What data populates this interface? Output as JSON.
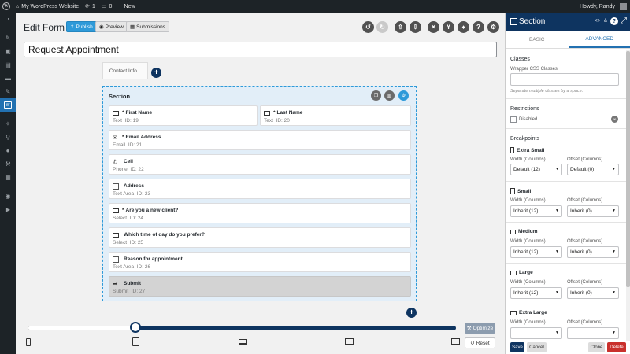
{
  "admin_bar": {
    "site_name": "My WordPress Website",
    "updates_count": "1",
    "comments_count": "0",
    "new_label": "New",
    "greeting": "Howdy, Randy"
  },
  "builder": {
    "title": "Edit Form",
    "publish_label": "Publish",
    "preview_label": "Preview",
    "submissions_label": "Submissions",
    "form_title": "Request Appointment",
    "page_tab": "Contact Info..."
  },
  "section": {
    "label": "Section",
    "fields": [
      {
        "label": "First Name",
        "required": "*",
        "type": "Text",
        "id": "ID: 19"
      },
      {
        "label": "Last Name",
        "required": "*",
        "type": "Text",
        "id": "ID: 20"
      },
      {
        "label": "Email Address",
        "required": "*",
        "type": "Email",
        "id": "ID: 21"
      },
      {
        "label": "Cell",
        "required": "",
        "type": "Phone",
        "id": "ID: 22"
      },
      {
        "label": "Address",
        "required": "",
        "type": "Text Area",
        "id": "ID: 23"
      },
      {
        "label": "Are you a new client?",
        "required": "*",
        "type": "Select",
        "id": "ID: 24"
      },
      {
        "label": "Which time of day do you prefer?",
        "required": "",
        "type": "Select",
        "id": "ID: 25"
      },
      {
        "label": "Reason for appointment",
        "required": "",
        "type": "Text Area",
        "id": "ID: 26"
      },
      {
        "label": "Submit",
        "required": "",
        "type": "Submit",
        "id": "ID: 27"
      }
    ]
  },
  "controls": {
    "optimize_label": "Optimize",
    "reset_label": "Reset"
  },
  "panel": {
    "title": "Section",
    "tabs": [
      "BASIC",
      "ADVANCED"
    ],
    "active_tab": "ADVANCED",
    "classes_heading": "Classes",
    "wrapper_css_label": "Wrapper CSS Classes",
    "wrapper_css_value": "",
    "wrapper_css_help": "Separate multiple classes by a space.",
    "restrictions_heading": "Restrictions",
    "disabled_label": "Disabled",
    "breakpoints_heading": "Breakpoints",
    "width_label": "Width (Columns)",
    "offset_label": "Offset (Columns)",
    "breakpoints": [
      {
        "name": "Extra Small",
        "width": "Default (12)",
        "offset": "Default (0)"
      },
      {
        "name": "Small",
        "width": "Inherit (12)",
        "offset": "Inherit (0)"
      },
      {
        "name": "Medium",
        "width": "Inherit (12)",
        "offset": "Inherit (0)"
      },
      {
        "name": "Large",
        "width": "Inherit (12)",
        "offset": "Inherit (0)"
      },
      {
        "name": "Extra Large",
        "width": "",
        "offset": ""
      }
    ],
    "save_label": "Save",
    "cancel_label": "Cancel",
    "clone_label": "Clone",
    "delete_label": "Delete"
  },
  "colors": {
    "primary_navy": "#0e3460",
    "accent_blue": "#2e9ad9",
    "delete_red": "#c9302c"
  }
}
